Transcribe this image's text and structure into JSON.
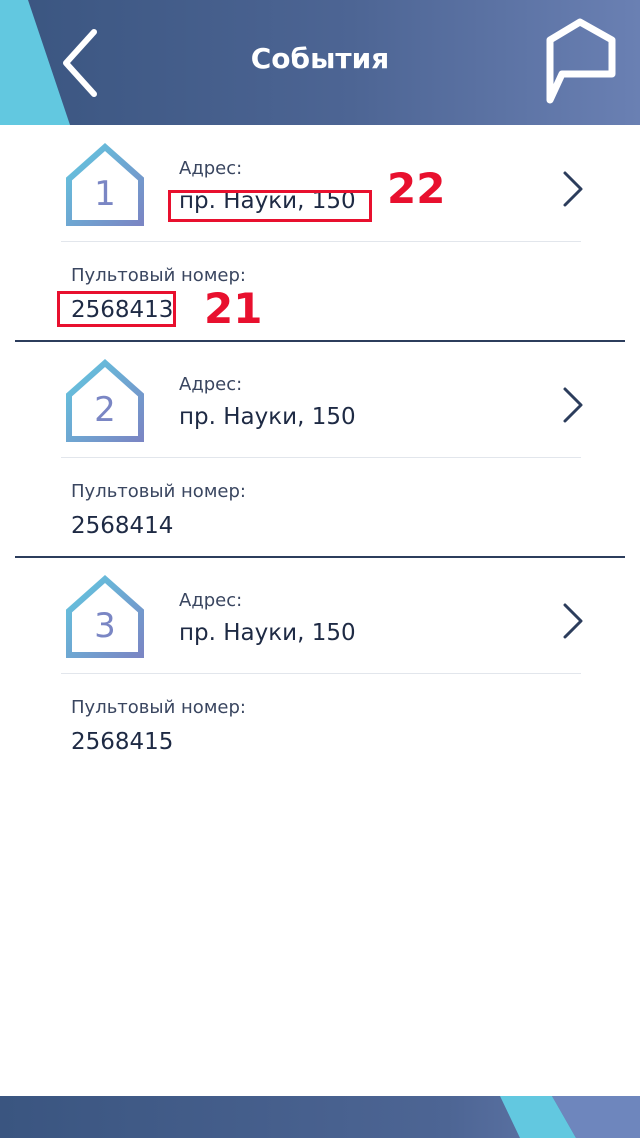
{
  "header": {
    "title": "События"
  },
  "events": [
    {
      "number": "1",
      "address_label": "Адрес:",
      "address": "пр. Науки, 150",
      "console_label": "Пультовый номер:",
      "console_number": "2568413"
    },
    {
      "number": "2",
      "address_label": "Адрес:",
      "address": "пр. Науки, 150",
      "console_label": "Пультовый номер:",
      "console_number": "2568414"
    },
    {
      "number": "3",
      "address_label": "Адрес:",
      "address": "пр. Науки, 150",
      "console_label": "Пультовый номер:",
      "console_number": "2568415"
    }
  ],
  "annotations": {
    "address_marker": "22",
    "console_marker": "21",
    "color": "#e8102e"
  },
  "colors": {
    "header_bg": "#4d6594",
    "accent": "#62c8e0",
    "text": "#1e2a44"
  },
  "icons": {
    "back": "chevron-left-icon",
    "flag": "flag-icon",
    "house": "house-icon",
    "next": "chevron-right-icon"
  }
}
